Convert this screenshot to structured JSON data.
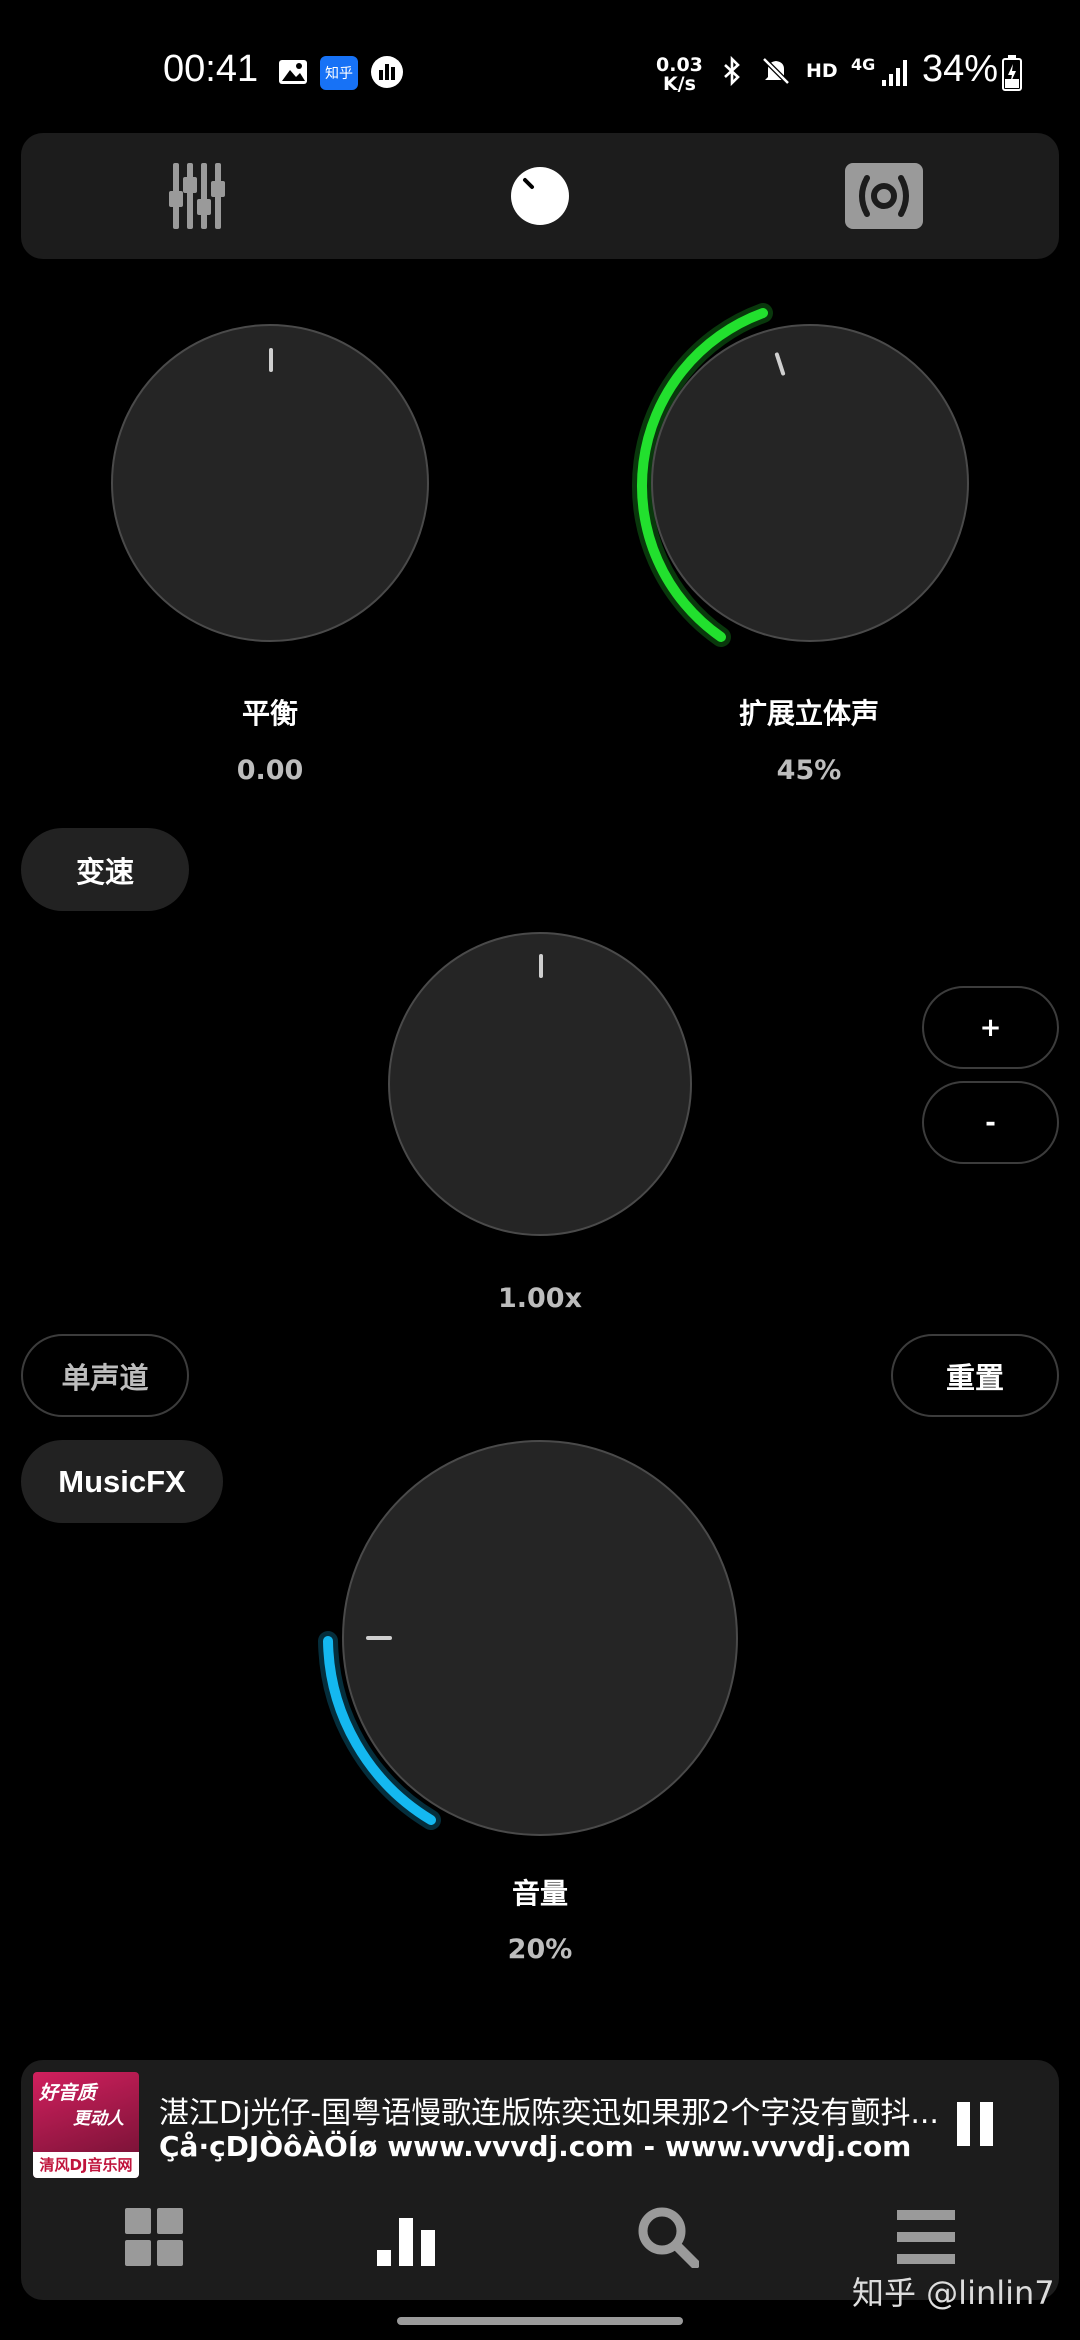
{
  "status_bar": {
    "time": "00:41",
    "zhihu_badge": "知乎",
    "net_speed_value": "0.03",
    "net_speed_unit": "K/s",
    "hd": "HD",
    "network": "4G",
    "battery": "34%",
    "icons": [
      "image-icon",
      "zhihu-icon",
      "app-notification-icon",
      "bluetooth-icon",
      "mute-icon",
      "signal-icon",
      "battery-icon"
    ]
  },
  "tabs": [
    {
      "name": "equalizer-tab",
      "icon": "equalizer-sliders-icon"
    },
    {
      "name": "effects-tab",
      "icon": "knob-icon"
    },
    {
      "name": "surround-tab",
      "icon": "speaker-icon"
    }
  ],
  "knobs": {
    "balance": {
      "label": "平衡",
      "value": "0.00"
    },
    "stereo": {
      "label": "扩展立体声",
      "value": "45%",
      "accent": "#22e02e"
    },
    "speed": {
      "value": "1.00x"
    },
    "volume": {
      "label": "音量",
      "value": "20%",
      "accent": "#14b8f0"
    }
  },
  "buttons": {
    "speed_toggle": "变速",
    "plus": "+",
    "minus": "-",
    "mono": "单声道",
    "reset": "重置",
    "musicfx": "MusicFX"
  },
  "now_playing": {
    "title": "湛江Dj光仔-国粤语慢歌连版陈奕迅如果那2个字没有颤抖...",
    "artist": "Çå·çDJÒôÀÖÍø www.vvvdj.com - www.vvvdj.com",
    "cover_text_top": "好音质",
    "cover_text_mid": "更动人",
    "cover_text_bottom": "清风DJ音乐网"
  },
  "bottom_nav": [
    "grid-icon",
    "bars-chart-icon",
    "search-icon",
    "menu-icon"
  ],
  "watermark": "知乎 @linlin7"
}
